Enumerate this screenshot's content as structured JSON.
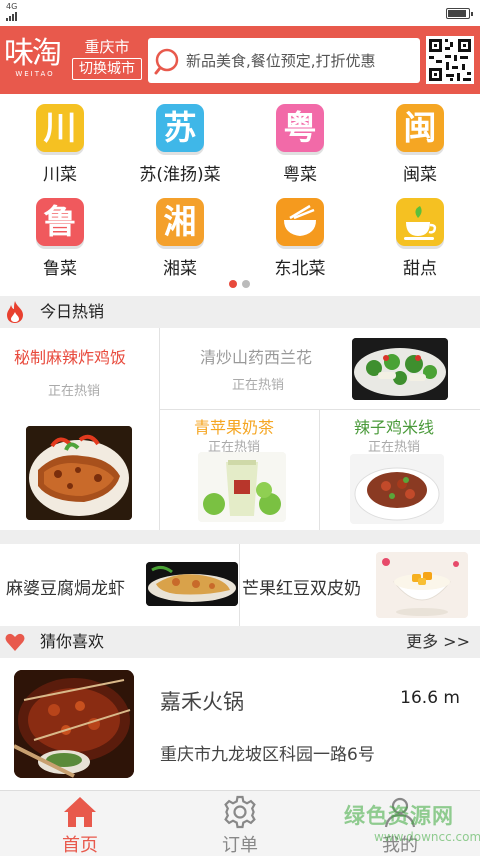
{
  "status_bar": {
    "network": "4G"
  },
  "header": {
    "logo_text": "味淘",
    "logo_sub": "WEITAO",
    "city": "重庆市",
    "switch_city_label": "切换城市",
    "search_placeholder": "新品美食,餐位预定,打折优惠",
    "accent_color": "#e8594c"
  },
  "categories": [
    {
      "label": "川菜",
      "glyph": "川",
      "color": "#f5c122"
    },
    {
      "label": "苏(淮扬)菜",
      "glyph": "苏",
      "color": "#3fb7e8"
    },
    {
      "label": "粤菜",
      "glyph": "粤",
      "color": "#f26aa8"
    },
    {
      "label": "闽菜",
      "glyph": "闽",
      "color": "#f5a623"
    },
    {
      "label": "鲁菜",
      "glyph": "鲁",
      "color": "#f0595d"
    },
    {
      "label": "湘菜",
      "glyph": "湘",
      "color": "#f4a02b"
    },
    {
      "label": "东北菜",
      "glyph": "bowl-icon",
      "color": "#f59a1e"
    },
    {
      "label": "甜点",
      "glyph": "teacup-icon",
      "color": "#f5c122"
    }
  ],
  "pager": {
    "current": 1,
    "total": 2
  },
  "hot_section": {
    "title": "今日热销",
    "items": [
      {
        "title": "秘制麻辣炸鸡饭",
        "status": "正在热销",
        "title_color": "#e84a3c"
      },
      {
        "title": "清炒山药西兰花",
        "status": "正在热销",
        "title_color": "#999999"
      },
      {
        "title": "青苹果奶茶",
        "status": "正在热销",
        "title_color": "#f5a623"
      },
      {
        "title": "辣子鸡米线",
        "status": "正在热销",
        "title_color": "#4a9a3a"
      }
    ]
  },
  "promos": [
    {
      "title": "麻婆豆腐焗龙虾"
    },
    {
      "title": "芒果红豆双皮奶"
    }
  ],
  "recommend_section": {
    "title": "猜你喜欢",
    "more_label": "更多 >>",
    "items": [
      {
        "name": "嘉禾火锅",
        "distance": "16.6 m",
        "address": "重庆市九龙坡区科园一路6号"
      }
    ]
  },
  "tabbar": {
    "items": [
      {
        "label": "首页",
        "icon": "home-icon",
        "active": true
      },
      {
        "label": "订单",
        "icon": "gear-icon",
        "active": false
      },
      {
        "label": "我的",
        "icon": "user-icon",
        "active": false
      }
    ]
  },
  "watermark": {
    "main": "绿色资源网",
    "sub": "www.downcc.com"
  }
}
